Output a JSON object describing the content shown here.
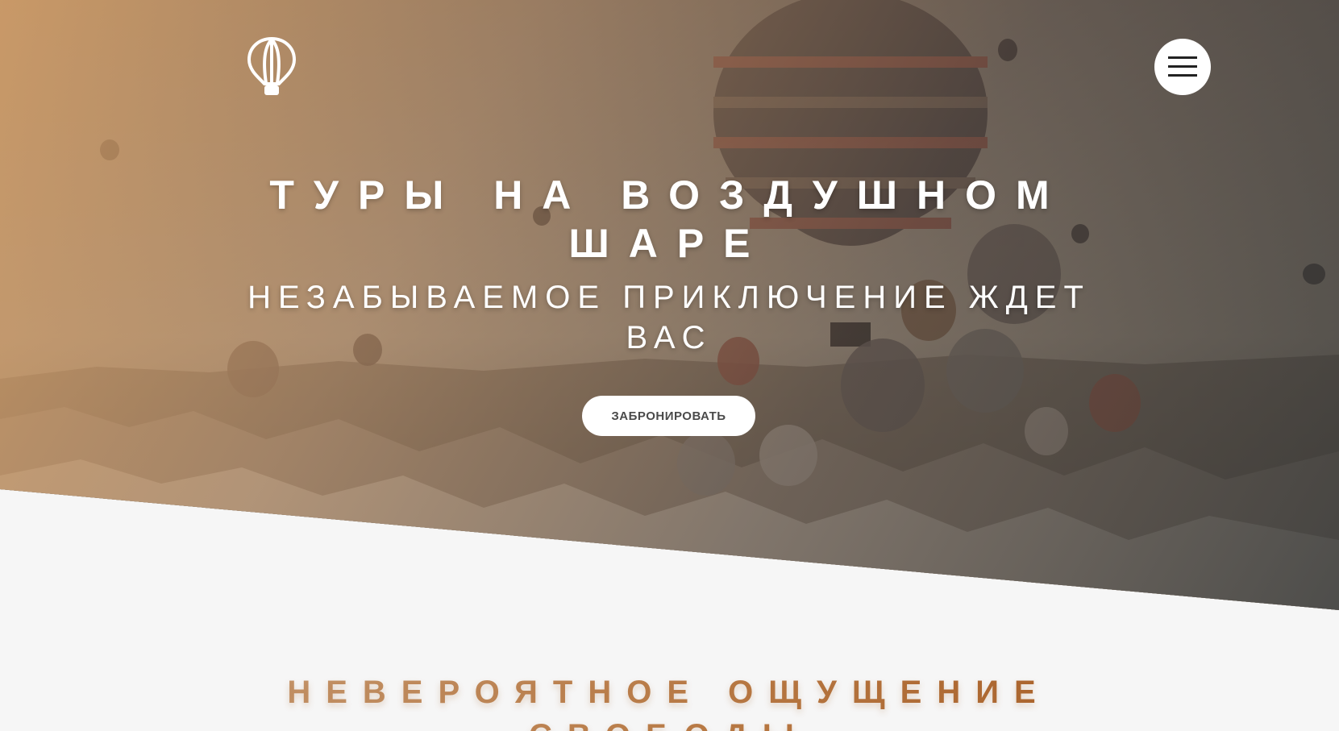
{
  "header": {
    "logo": "hot-air-balloon-icon",
    "menu_icon": "hamburger-icon"
  },
  "hero": {
    "title": "ТУРЫ НА ВОЗДУШНОМ ШАРЕ",
    "subtitle": "НЕЗАБЫВАЕМОЕ ПРИКЛЮЧЕНИЕ ЖДЕТ ВАС",
    "cta_label": "ЗАБРОНИРОВАТЬ"
  },
  "section": {
    "title": "НЕВЕРОЯТНОЕ ОЩУЩЕНИЕ СВОБОДЫ"
  },
  "colors": {
    "hero_overlay_left": "#d6a068",
    "hero_overlay_right": "#2c3032",
    "page_background": "#f6f6f6",
    "accent_gradient_start": "#c79a72",
    "accent_gradient_end": "#a85e26",
    "button_background": "#ffffff",
    "button_text": "#4a4a4a"
  }
}
